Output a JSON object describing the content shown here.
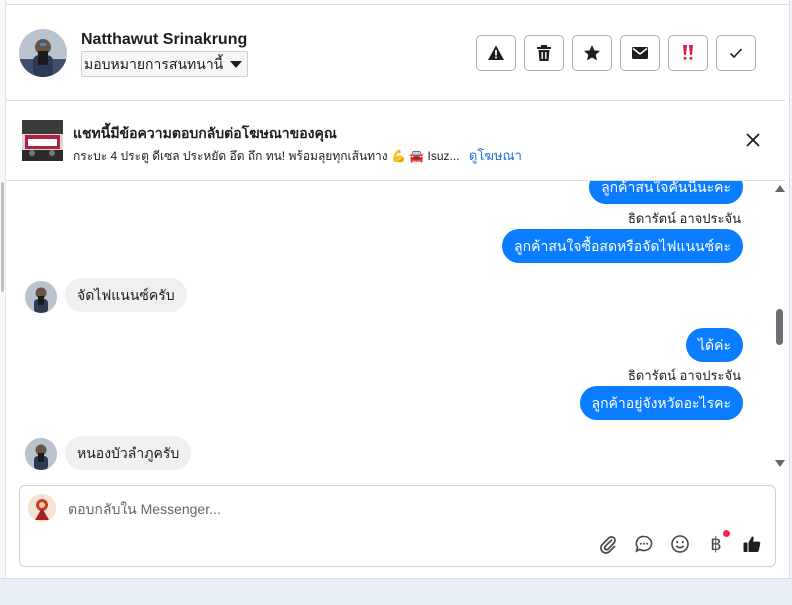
{
  "header": {
    "contact_name": "Natthawut Srinakrung",
    "assign_label": "มอบหมายการสนทนานี้",
    "actions": [
      {
        "name": "report-spam-button",
        "icon": "warning-icon"
      },
      {
        "name": "delete-button",
        "icon": "trash-icon"
      },
      {
        "name": "follow-up-button",
        "icon": "star-icon"
      },
      {
        "name": "mark-unread-button",
        "icon": "envelope-icon"
      },
      {
        "name": "priority-button",
        "icon": "double-exclamation-icon"
      },
      {
        "name": "mark-done-button",
        "icon": "checkmark-icon"
      }
    ]
  },
  "ad_banner": {
    "title": "แชทนี้มีข้อความตอบกลับต่อโฆษณาของคุณ",
    "description": "กระบะ 4 ประตู ดีเซล ประหยัด อึด ถึก ทน! พร้อมลุยทุกเส้นทาง 💪 🚘 Isuz...",
    "link_label": "ดูโฆษณา"
  },
  "messages": [
    {
      "direction": "out",
      "text": "ลูกค้าสนใจคันนี้นะคะ"
    },
    {
      "direction": "label",
      "text": "ธิดารัตน์ อาจประจัน"
    },
    {
      "direction": "out",
      "text": "ลูกค้าสนใจซื้อสดหรือจัดไฟแนนซ์คะ"
    },
    {
      "direction": "in",
      "text": "จัดไฟแนนซ์ครับ"
    },
    {
      "direction": "out",
      "text": "ได้ค่ะ"
    },
    {
      "direction": "label",
      "text": "ธิดารัตน์ อาจประจัน"
    },
    {
      "direction": "out",
      "text": "ลูกค้าอยู่จังหวัดอะไรคะ"
    },
    {
      "direction": "in",
      "text": "หนองบัวลำภูครับ"
    }
  ],
  "composer": {
    "placeholder": "ตอบกลับใน Messenger...",
    "tools": [
      "paperclip-icon",
      "chat-bubble-icon",
      "emoji-icon",
      "baht-icon",
      "thumbs-up-icon"
    ],
    "baht_glyph": "฿"
  },
  "colors": {
    "outgoing_bubble": "#0a7cff",
    "incoming_bubble": "#f0f0f0",
    "link": "#216fdb",
    "priority_red": "#f02849"
  }
}
